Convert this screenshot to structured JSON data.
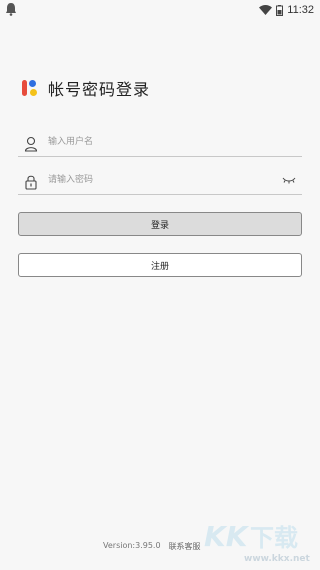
{
  "status_bar": {
    "time": "11:32"
  },
  "brand": {
    "title": "帐号密码登录"
  },
  "form": {
    "username_placeholder": "输入用户名",
    "password_placeholder": "请输入密码"
  },
  "buttons": {
    "login": "登录",
    "register": "注册"
  },
  "footer": {
    "version": "Version:3.95.0",
    "support_link": "联系客服"
  },
  "watermark": {
    "brand": "KK下载",
    "url": "www.kkx.net"
  },
  "colors": {
    "logo_red": "#e74c3c",
    "logo_blue": "#2f6fe0",
    "logo_yellow": "#f4c21a",
    "login_bg": "#dcdcdc"
  }
}
